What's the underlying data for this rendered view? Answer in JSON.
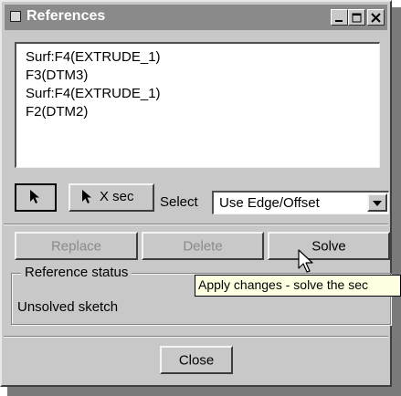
{
  "window": {
    "title": "References",
    "controls": [
      "minimize",
      "maximize",
      "close"
    ]
  },
  "references": {
    "items": [
      "Surf:F4(EXTRUDE_1)",
      "F3(DTM3)",
      "Surf:F4(EXTRUDE_1)",
      "F2(DTM2)"
    ]
  },
  "toolbar": {
    "arrow_icon": "arrow-pointer-icon",
    "xsec_label": "X sec",
    "select_label": "Select",
    "select_value": "Use Edge/Offset"
  },
  "actions": {
    "replace_label": "Replace",
    "delete_label": "Delete",
    "solve_label": "Solve"
  },
  "reference_status": {
    "legend": "Reference status",
    "value": "Unsolved sketch"
  },
  "tooltip": {
    "text": "Apply changes - solve the sec"
  },
  "footer": {
    "close_label": "Close"
  }
}
